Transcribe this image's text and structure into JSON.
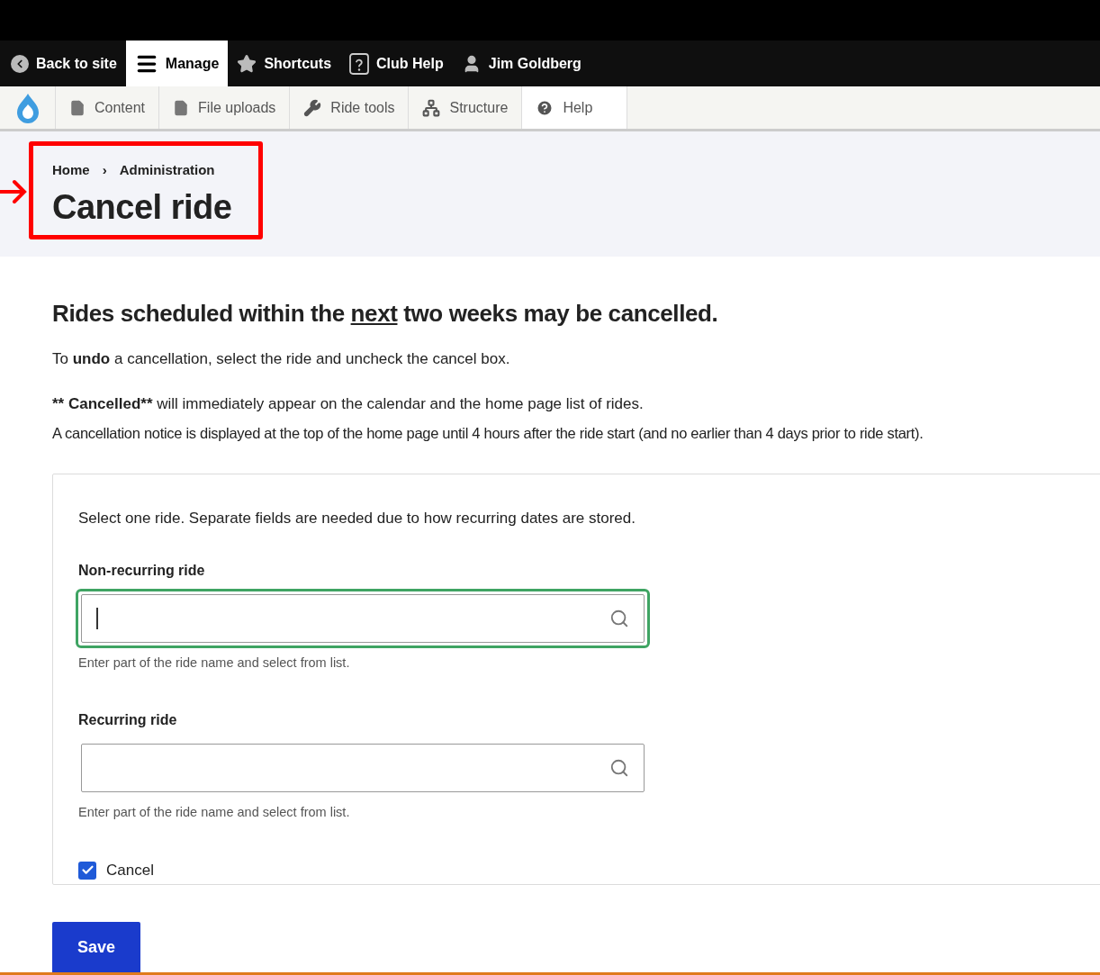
{
  "toolbar": {
    "items": [
      {
        "label": "Back to site",
        "kind": "back",
        "selected": false
      },
      {
        "label": "Manage",
        "kind": "menu",
        "selected": true
      },
      {
        "label": "Shortcuts",
        "kind": "star",
        "selected": false
      },
      {
        "label": "Club Help",
        "kind": "question",
        "selected": false
      },
      {
        "label": "Jim Goldberg",
        "kind": "user",
        "selected": false
      }
    ]
  },
  "tray": {
    "items": [
      {
        "label": "Content",
        "kind": "file",
        "selected": false
      },
      {
        "label": "File uploads",
        "kind": "file",
        "selected": false
      },
      {
        "label": "Ride tools",
        "kind": "wrench",
        "selected": false
      },
      {
        "label": "Structure",
        "kind": "structure",
        "selected": false
      },
      {
        "label": "Help",
        "kind": "help",
        "selected": true
      }
    ]
  },
  "breadcrumb": {
    "items": [
      "Home",
      "Administration"
    ],
    "separator": "›"
  },
  "title": "Cancel ride",
  "heading": {
    "before": "Rides scheduled within the ",
    "underlined": "next",
    "after": " two weeks may be cancelled."
  },
  "undo_note": "To **undo** a cancellation, select the ride and uncheck the cancel box.",
  "notice": {
    "bold": "** Cancelled**",
    "rest": " will immediately appear on the calendar and the home page list of rides."
  },
  "notice_detail": "A cancellation notice is displayed at the top of the home page until 4 hours after the ride start (and no earlier than 4 days prior to ride start).",
  "form": {
    "description": "Select one ride. Separate fields are needed due to how recurring dates are stored.",
    "fields": [
      {
        "label": "Non-recurring ride",
        "focused": true,
        "description": "Enter part of the ride name and select from list."
      },
      {
        "label": "Recurring ride",
        "focused": false,
        "description": "Enter part of the ride name and select from list."
      }
    ],
    "checkbox": {
      "label": "Cancel",
      "checked": true
    }
  },
  "save_button": "Save"
}
